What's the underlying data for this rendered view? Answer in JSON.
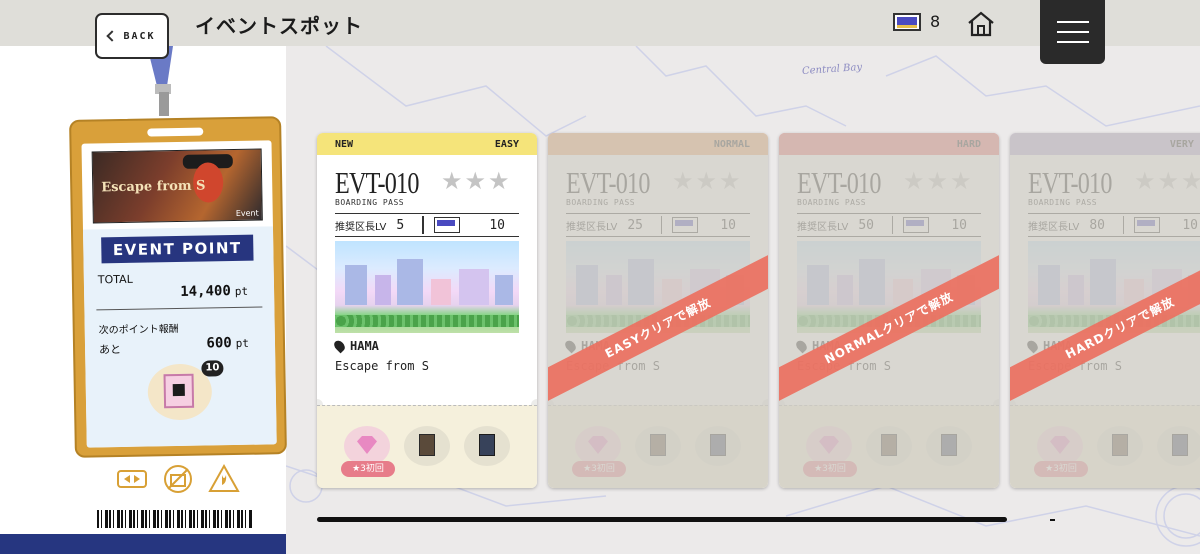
{
  "header": {
    "back_label": "BACK",
    "title": "イベントスポット",
    "ticket_count": "8"
  },
  "map": {
    "label": "Central Bay"
  },
  "event_badge": {
    "banner_title": "Escape from S",
    "banner_tag": "Event",
    "heading": "EVENT POINT",
    "total_label": "TOTAL",
    "total_value": "14,400",
    "total_unit": "pt",
    "next_reward_label": "次のポイント報酬",
    "remaining_label": "あと",
    "remaining_value": "600",
    "remaining_unit": "pt",
    "reward_count": "10"
  },
  "cards": [
    {
      "tag": "NEW",
      "difficulty": "EASY",
      "code": "EVT-010",
      "pass_label": "BOARDING PASS",
      "lv_label": "推奨区長LV",
      "lv_value": "5",
      "ticket_value": "10",
      "location": "HAMA",
      "subtitle": "Escape from S",
      "first_clear": "★3初回",
      "head_color": "#f5e47a",
      "unlock_text": ""
    },
    {
      "tag": "",
      "difficulty": "NORMAL",
      "code": "EVT-010",
      "pass_label": "BOARDING PASS",
      "lv_label": "推奨区長LV",
      "lv_value": "25",
      "ticket_value": "10",
      "location": "HAMA",
      "subtitle": "Escape from S",
      "first_clear": "★3初回",
      "head_color": "#f2a56a",
      "unlock_text": "EASYクリアで解放"
    },
    {
      "tag": "",
      "difficulty": "HARD",
      "code": "EVT-010",
      "pass_label": "BOARDING PASS",
      "lv_label": "推奨区長LV",
      "lv_value": "50",
      "ticket_value": "10",
      "location": "HAMA",
      "subtitle": "Escape from S",
      "first_clear": "★3初回",
      "head_color": "#ec6e6e",
      "unlock_text": "NORMALクリアで解放"
    },
    {
      "tag": "",
      "difficulty": "VERY HA",
      "code": "EVT-010",
      "pass_label": "BOARDING PASS",
      "lv_label": "推奨区長LV",
      "lv_value": "80",
      "ticket_value": "10",
      "location": "HAMA",
      "subtitle": "Escape from S",
      "first_clear": "★3初回",
      "head_color": "#b8a8d8",
      "unlock_text": "HARDクリアで解放"
    }
  ]
}
